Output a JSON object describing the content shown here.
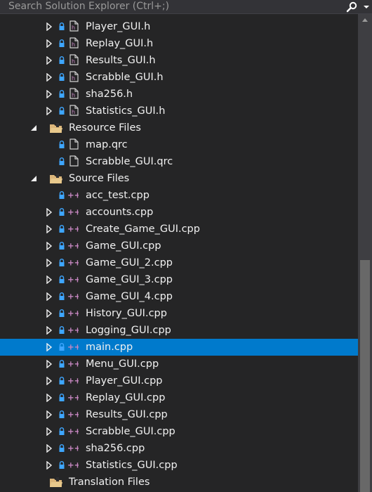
{
  "search": {
    "placeholder": "Search Solution Explorer (Ctrl+;)"
  },
  "colors": {
    "background": "#252526",
    "selection": "#007acc",
    "header_file_icon": "#c586c0",
    "cpp_file_icon": "#c586c0",
    "lock_icon": "#3ea6ff",
    "folder_icon": "#dcb67a",
    "text": "#f1f1f1"
  },
  "rows": [
    {
      "label": "Player_GUI.h",
      "type": "header",
      "expander": "collapsed",
      "level": 2
    },
    {
      "label": "Replay_GUI.h",
      "type": "header",
      "expander": "collapsed",
      "level": 2
    },
    {
      "label": "Results_GUI.h",
      "type": "header",
      "expander": "collapsed",
      "level": 2
    },
    {
      "label": "Scrabble_GUI.h",
      "type": "header",
      "expander": "collapsed",
      "level": 2
    },
    {
      "label": "sha256.h",
      "type": "header",
      "expander": "collapsed",
      "level": 2
    },
    {
      "label": "Statistics_GUI.h",
      "type": "header",
      "expander": "collapsed",
      "level": 2
    },
    {
      "label": "Resource Files",
      "type": "folder",
      "expander": "expanded",
      "level": 1
    },
    {
      "label": "map.qrc",
      "type": "resource",
      "expander": "none",
      "level": 2
    },
    {
      "label": "Scrabble_GUI.qrc",
      "type": "resource",
      "expander": "none",
      "level": 2
    },
    {
      "label": "Source Files",
      "type": "folder",
      "expander": "expanded",
      "level": 1
    },
    {
      "label": "acc_test.cpp",
      "type": "cpp",
      "expander": "none",
      "level": 2
    },
    {
      "label": "accounts.cpp",
      "type": "cpp",
      "expander": "collapsed",
      "level": 2
    },
    {
      "label": "Create_Game_GUI.cpp",
      "type": "cpp",
      "expander": "collapsed",
      "level": 2
    },
    {
      "label": "Game_GUI.cpp",
      "type": "cpp",
      "expander": "collapsed",
      "level": 2
    },
    {
      "label": "Game_GUI_2.cpp",
      "type": "cpp",
      "expander": "collapsed",
      "level": 2
    },
    {
      "label": "Game_GUI_3.cpp",
      "type": "cpp",
      "expander": "collapsed",
      "level": 2
    },
    {
      "label": "Game_GUI_4.cpp",
      "type": "cpp",
      "expander": "collapsed",
      "level": 2
    },
    {
      "label": "History_GUI.cpp",
      "type": "cpp",
      "expander": "collapsed",
      "level": 2
    },
    {
      "label": "Logging_GUI.cpp",
      "type": "cpp",
      "expander": "collapsed",
      "level": 2
    },
    {
      "label": "main.cpp",
      "type": "cpp",
      "expander": "collapsed",
      "level": 2,
      "selected": true
    },
    {
      "label": "Menu_GUI.cpp",
      "type": "cpp",
      "expander": "collapsed",
      "level": 2
    },
    {
      "label": "Player_GUI.cpp",
      "type": "cpp",
      "expander": "collapsed",
      "level": 2
    },
    {
      "label": "Replay_GUI.cpp",
      "type": "cpp",
      "expander": "collapsed",
      "level": 2
    },
    {
      "label": "Results_GUI.cpp",
      "type": "cpp",
      "expander": "collapsed",
      "level": 2
    },
    {
      "label": "Scrabble_GUI.cpp",
      "type": "cpp",
      "expander": "collapsed",
      "level": 2
    },
    {
      "label": "sha256.cpp",
      "type": "cpp",
      "expander": "collapsed",
      "level": 2
    },
    {
      "label": "Statistics_GUI.cpp",
      "type": "cpp",
      "expander": "collapsed",
      "level": 2
    },
    {
      "label": "Translation Files",
      "type": "folder",
      "expander": "none",
      "level": 1
    }
  ]
}
